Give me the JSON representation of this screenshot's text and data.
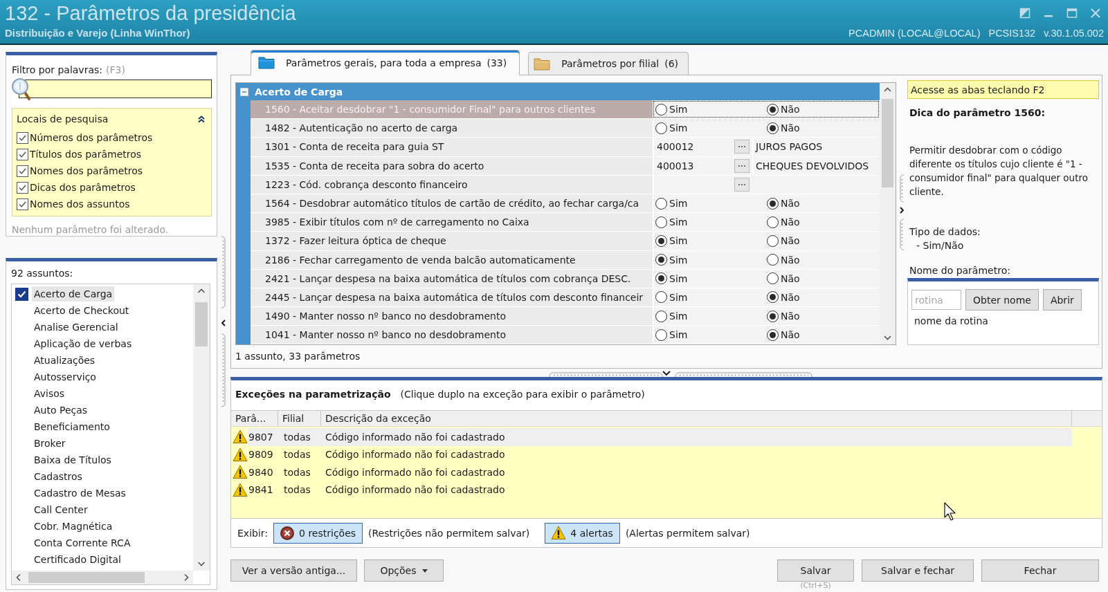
{
  "window": {
    "title": "132 - Parâmetros da presidência",
    "subtitle": "Distribuição e Varejo (Linha WinThor)",
    "user": "PCADMIN (LOCAL@LOCAL)",
    "module": "PCSIS132",
    "version": "v.30.1.05.002"
  },
  "filter": {
    "label": "Filtro por palavras:",
    "shortcut": "(F3)",
    "search_locations": {
      "title": "Locais de pesquisa",
      "expanded": true,
      "options": [
        {
          "label": "Números dos parâmetros",
          "checked": true
        },
        {
          "label": "Títulos dos parâmetros",
          "checked": true
        },
        {
          "label": "Nomes dos parâmetros",
          "checked": true
        },
        {
          "label": "Dicas dos parâmetros",
          "checked": true
        },
        {
          "label": "Nomes dos assuntos",
          "checked": true
        }
      ]
    },
    "status": "Nenhum parâmetro foi alterado."
  },
  "subjects": {
    "count": "92 assuntos:",
    "items": [
      {
        "label": "Acerto de Carga",
        "checked": true,
        "selected": true
      },
      {
        "label": "Acerto de Checkout",
        "checked": false,
        "selected": false
      },
      {
        "label": "Analise Gerencial",
        "checked": false,
        "selected": false
      },
      {
        "label": "Aplicação de verbas",
        "checked": false,
        "selected": false
      },
      {
        "label": "Atualizações",
        "checked": false,
        "selected": false
      },
      {
        "label": "Autosserviço",
        "checked": false,
        "selected": false
      },
      {
        "label": "Avisos",
        "checked": false,
        "selected": false
      },
      {
        "label": "Auto Peças",
        "checked": false,
        "selected": false
      },
      {
        "label": "Beneficiamento",
        "checked": false,
        "selected": false
      },
      {
        "label": "Broker",
        "checked": false,
        "selected": false
      },
      {
        "label": "Baixa de Títulos",
        "checked": false,
        "selected": false
      },
      {
        "label": "Cadastros",
        "checked": false,
        "selected": false
      },
      {
        "label": "Cadastro de Mesas",
        "checked": false,
        "selected": false
      },
      {
        "label": "Call Center",
        "checked": false,
        "selected": false
      },
      {
        "label": "Cobr. Magnética",
        "checked": false,
        "selected": false
      },
      {
        "label": "Conta Corrente RCA",
        "checked": false,
        "selected": false
      },
      {
        "label": "Certificado Digital",
        "checked": false,
        "selected": false
      }
    ]
  },
  "tabs": [
    {
      "label": "Parâmetros gerais, para toda a empresa",
      "count": "(33)",
      "selected": true
    },
    {
      "label": "Parâmetros por filial",
      "count": "(6)",
      "selected": false
    }
  ],
  "parameters": {
    "group": {
      "title": "Acerto de Carga",
      "expanded": true
    },
    "rows": [
      {
        "kind": "yesno",
        "label": "1560 - Aceitar desdobrar \"1 - consumidor Final\" para outros clientes",
        "selected": true,
        "options": [
          {
            "label": "Sim",
            "selected": false
          },
          {
            "label": "Não",
            "selected": true
          }
        ]
      },
      {
        "kind": "yesno",
        "label": "1482 - Autenticação no acerto de carga",
        "selected": false,
        "options": [
          {
            "label": "Sim",
            "selected": false
          },
          {
            "label": "Não",
            "selected": true
          }
        ]
      },
      {
        "kind": "code",
        "label": "1301 - Conta de receita para guia ST",
        "selected": false,
        "code": "400012",
        "description": "JUROS PAGOS"
      },
      {
        "kind": "code",
        "label": "1535 - Conta de receita para sobra do acerto",
        "selected": false,
        "code": "400013",
        "description": "CHEQUES DEVOLVIDOS"
      },
      {
        "kind": "code",
        "label": "1223 - Cód. cobrança desconto financeiro",
        "selected": false
      },
      {
        "kind": "yesno",
        "label": "1564 - Desdobrar automático títulos de cartão de crédito, ao fechar carga/ca",
        "selected": false,
        "options": [
          {
            "label": "Sim",
            "selected": false
          },
          {
            "label": "Não",
            "selected": true
          }
        ]
      },
      {
        "kind": "yesno",
        "label": "3985 - Exibir títulos com nº de carregamento no Caixa",
        "selected": false,
        "options": [
          {
            "label": "Sim",
            "selected": false
          },
          {
            "label": "Não",
            "selected": false
          }
        ]
      },
      {
        "kind": "yesno",
        "label": "1372 - Fazer leitura óptica de cheque",
        "selected": false,
        "options": [
          {
            "label": "Sim",
            "selected": true
          },
          {
            "label": "Não",
            "selected": false
          }
        ]
      },
      {
        "kind": "yesno",
        "label": "2186 - Fechar carregamento de venda balcão automaticamente",
        "selected": false,
        "options": [
          {
            "label": "Sim",
            "selected": true
          },
          {
            "label": "Não",
            "selected": false
          }
        ]
      },
      {
        "kind": "yesno",
        "label": "2421 - Lançar despesa na baixa automática de títulos com cobrança DESC.",
        "selected": false,
        "options": [
          {
            "label": "Sim",
            "selected": true
          },
          {
            "label": "Não",
            "selected": false
          }
        ]
      },
      {
        "kind": "yesno",
        "label": "2445 - Lançar despesa na baixa automática de títulos com desconto financeir",
        "selected": false,
        "options": [
          {
            "label": "Sim",
            "selected": false
          },
          {
            "label": "Não",
            "selected": true
          }
        ]
      },
      {
        "kind": "yesno",
        "label": "1490 - Manter nosso nº banco no desdobramento",
        "selected": false,
        "options": [
          {
            "label": "Sim",
            "selected": false
          },
          {
            "label": "Não",
            "selected": true
          }
        ]
      },
      {
        "kind": "yesno",
        "label": "1041 - Manter nosso nº banco no desdobramento",
        "selected": false,
        "options": [
          {
            "label": "Sim",
            "selected": false
          },
          {
            "label": "Não",
            "selected": true
          }
        ]
      }
    ],
    "summary": "1 assunto, 33 parâmetros"
  },
  "tip": {
    "hint": "Acesse as abas teclando F2",
    "title": "Dica do parâmetro 1560:",
    "text": "Permitir desdobrar com o código diferente os títulos cujo cliente é \"1 - consumidor final\" para qualquer outro cliente.",
    "data_type_label": "Tipo de dados:",
    "data_type": "- Sim/Não",
    "name_label": "Nome do parâmetro:",
    "routine": {
      "placeholder": "rotina",
      "buttons": [
        "Obter nome",
        "Abrir"
      ],
      "result": "nome da rotina"
    }
  },
  "exceptions": {
    "title": "Exceções na parametrização",
    "hint": "(Clique duplo na exceção para exibir o parâmetro)",
    "columns": [
      "Parâ...",
      "Filial",
      "Descrição da exceção"
    ],
    "rows": [
      {
        "kind": "alert",
        "parameter": "9807",
        "branch": "todas",
        "description": "Código informado não foi cadastrado",
        "selected": true
      },
      {
        "kind": "alert",
        "parameter": "9809",
        "branch": "todas",
        "description": "Código informado não foi cadastrado",
        "selected": false
      },
      {
        "kind": "alert",
        "parameter": "9840",
        "branch": "todas",
        "description": "Código informado não foi cadastrado",
        "selected": false
      },
      {
        "kind": "alert",
        "parameter": "9841",
        "branch": "todas",
        "description": "Código informado não foi cadastrado",
        "selected": false
      }
    ],
    "filter_label": "Exibir:",
    "filters": [
      {
        "kind": "restriction",
        "label": "0 restrições",
        "note": "(Restrições não permitem salvar)",
        "on": true
      },
      {
        "kind": "alert",
        "label": "4 alertas",
        "note": "(Alertas permitem salvar)",
        "on": true
      }
    ]
  },
  "actions": {
    "left": [
      {
        "kind": "plain",
        "label": "Ver a versão antiga..."
      },
      {
        "kind": "menu",
        "label": "Opções"
      }
    ],
    "right": [
      {
        "label": "Salvar",
        "shortcut": "(Ctrl+S)"
      },
      {
        "label": "Salvar e fechar"
      },
      {
        "label": "Fechar"
      }
    ]
  }
}
